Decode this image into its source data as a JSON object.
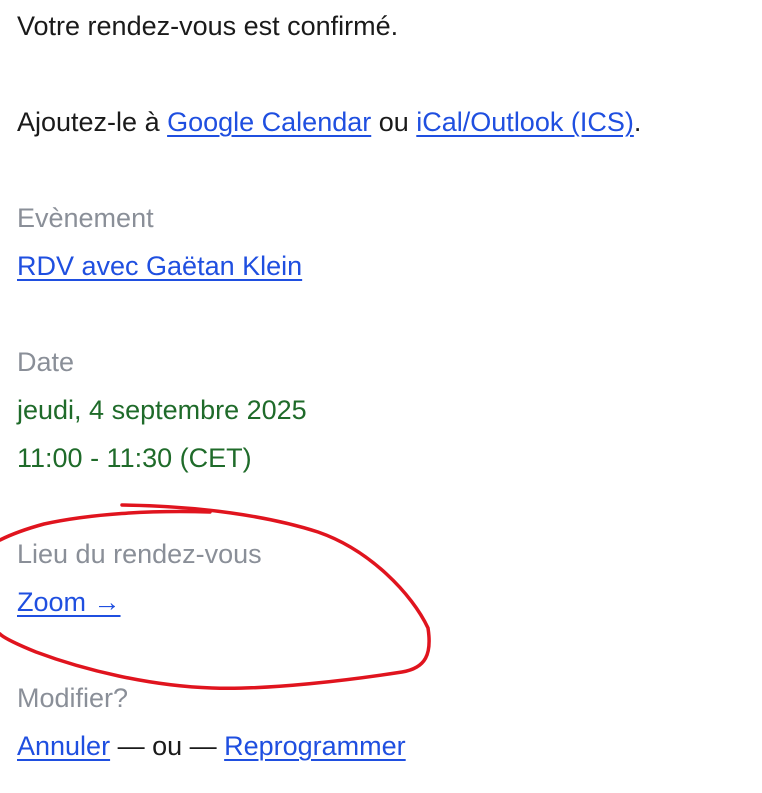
{
  "confirmation": {
    "text": "Votre rendez-vous est confirmé."
  },
  "add_to_calendar": {
    "prefix": "Ajoutez-le à ",
    "google_link": "Google Calendar",
    "connector": " ou ",
    "ics_link": "iCal/Outlook (ICS)",
    "suffix": "."
  },
  "event": {
    "label": "Evènement",
    "value": "RDV avec Gaëtan Klein"
  },
  "date": {
    "label": "Date",
    "day": "jeudi, 4 septembre 2025",
    "time": "11:00 - 11:30 (CET)"
  },
  "location": {
    "label": "Lieu du rendez-vous",
    "link": "Zoom →"
  },
  "modify": {
    "label": "Modifier?",
    "cancel_link": "Annuler",
    "separator": " — ou — ",
    "reschedule_link": "Reprogrammer"
  },
  "colors": {
    "link": "#1f4fe0",
    "label": "#8a8f98",
    "date": "#1f6b2a",
    "annotation": "#e0141e"
  }
}
